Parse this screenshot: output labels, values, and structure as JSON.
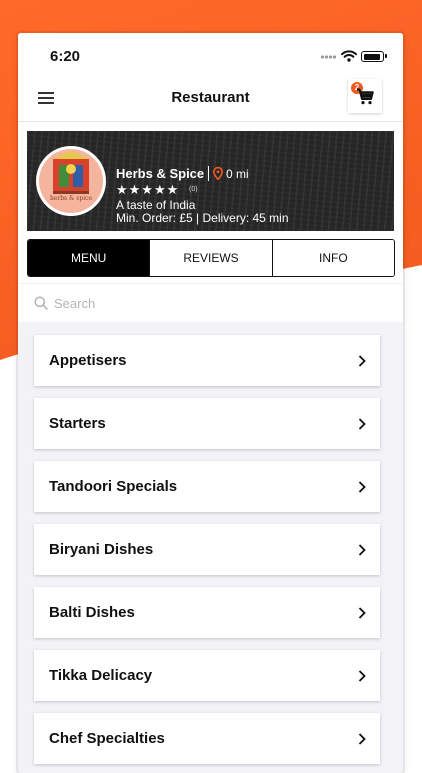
{
  "status_bar": {
    "time": "6:20"
  },
  "nav": {
    "title": "Restaurant",
    "cart_count": "2"
  },
  "restaurant": {
    "name": "Herbs & Spice",
    "distance": "0 mi",
    "stars": "★★★★★",
    "rating_count": "(0)",
    "tagline": "A taste of India",
    "order_info": "Min. Order: £5 | Delivery: 45 min",
    "logo_text": "herbs & spice"
  },
  "tabs": [
    {
      "label": "MENU",
      "active": true
    },
    {
      "label": "REVIEWS",
      "active": false
    },
    {
      "label": "INFO",
      "active": false
    }
  ],
  "search": {
    "placeholder": "Search",
    "value": ""
  },
  "categories": [
    "Appetisers",
    "Starters",
    "Tandoori Specials",
    "Biryani Dishes",
    "Balti Dishes",
    "Tikka Delicacy",
    "Chef Specialties"
  ],
  "colors": {
    "accent": "#f25a1d",
    "banner": "#262626"
  }
}
